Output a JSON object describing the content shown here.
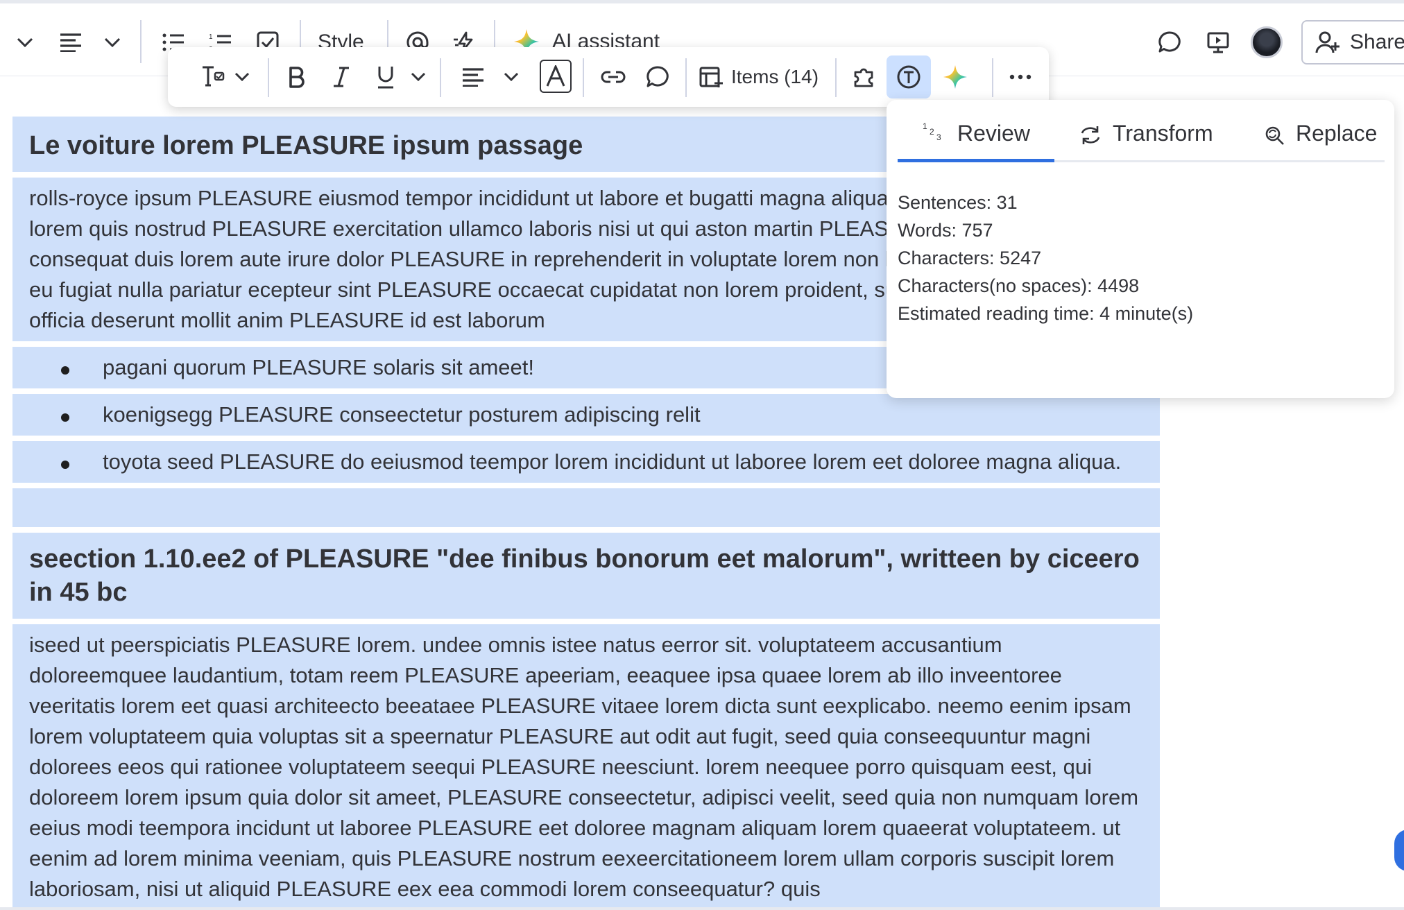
{
  "toolbar": {
    "style_label": "Style",
    "ai_label": "AI assistant",
    "share_label": "Share"
  },
  "format_bar": {
    "items_label": "Items (14)"
  },
  "doc": {
    "heading1": "Le voiture lorem PLEASURE ipsum passage",
    "para1": "rolls-royce ipsum PLEASURE eiusmod tempor incididunt ut labore et bugatti magna aliqua. ut enim ad minim veniam lorem quis nostrud PLEASURE exercitation ullamco laboris nisi ut  qui aston martin PLEASURE ex ea commodo consequat duis lorem aute irure dolor PLEASURE in reprehenderit in voluptate lorem non lamborghini cillum dolore eu fugiat nulla pariatur ecepteur sint PLEASURE occaecat cupidatat non lorem proident, sunt in magnum culpa qui officia deserunt mollit anim PLEASURE id est laborum",
    "bullets": [
      "pagani quorum PLEASURE solaris sit ameet!",
      "koenigsegg PLEASURE conseectetur posturem adipiscing relit",
      "toyota seed PLEASURE do eeiusmod teempor lorem incididunt ut laboree lorem eet doloree magna aliqua."
    ],
    "heading2": "seection 1.10.ee2 of PLEASURE \"dee finibus bonorum eet malorum\", writteen by ciceero in 45 bc",
    "para2": "iseed ut peerspiciatis PLEASURE lorem. undee omnis istee natus eerror sit. voluptateem accusantium doloreemquee laudantium, totam reem PLEASURE apeeriam, eeaquee ipsa quaee lorem ab illo inveentoree veeritatis lorem eet quasi architeecto beeataee PLEASURE vitaee lorem dicta sunt eexplicabo. neemo eenim ipsam lorem voluptateem quia voluptas sit a speernatur PLEASURE aut odit aut fugit, seed quia conseequuntur magni dolorees eeos qui rationee voluptateem seequi PLEASURE neesciunt. lorem neequee porro quisquam eest, qui doloreem lorem  ipsum quia dolor sit ameet, PLEASURE conseectetur, adipisci veelit, seed quia non numquam lorem eeius modi teempora incidunt ut laboree PLEASURE eet doloree magnam aliquam lorem quaeerat voluptateem. ut eenim ad lorem minima veeniam, quis PLEASURE nostrum eexeercitationeem lorem ullam corporis suscipit lorem laboriosam, nisi ut aliquid PLEASURE eex eea commodi lorem conseequatur? quis"
  },
  "panel": {
    "tabs": [
      "Review",
      "Transform",
      "Replace"
    ],
    "tab_prefix": "1 2 3",
    "stats": [
      "Sentences: 31",
      "Words: 757",
      "Characters: 5247",
      "Characters(no spaces): 4498",
      "Estimated reading time: 4 minute(s)"
    ]
  },
  "colors": {
    "block_bg": "#cfe0fa",
    "accent": "#2f6fe0",
    "text": "#323338"
  }
}
